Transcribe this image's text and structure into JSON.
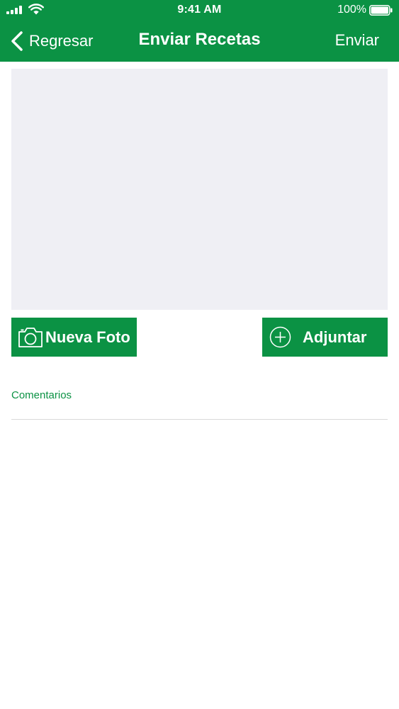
{
  "status_bar": {
    "time": "9:41 AM",
    "battery_percent": "100%",
    "battery_level": 1.0,
    "icons": [
      "signal-icon",
      "wifi-icon",
      "battery-icon"
    ]
  },
  "nav": {
    "back_label": "Regresar",
    "title": "Enviar Recetas",
    "send_label": "Enviar",
    "back_icon": "chevron-left-icon"
  },
  "actions": {
    "new_photo_label": "Nueva Foto",
    "new_photo_icon": "camera-icon",
    "attach_label": "Adjuntar",
    "attach_icon": "plus-circle-icon"
  },
  "comments": {
    "label": "Comentarios",
    "value": ""
  },
  "colors": {
    "brand_green": "#0b9244",
    "photo_placeholder": "#efeff4",
    "divider": "#d9d9d9"
  }
}
